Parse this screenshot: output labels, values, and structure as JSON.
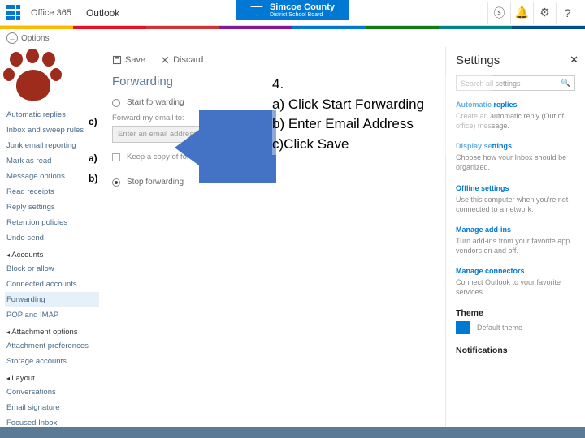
{
  "topbar": {
    "brand1": "Office 365",
    "brand2": "Outlook",
    "topcenter_line1": "Simcoe County",
    "topcenter_line2": "District School Board"
  },
  "subbar": {
    "options_label": "Options"
  },
  "leftnav": {
    "items": [
      "Automatic replies",
      "Inbox and sweep rules",
      "Junk email reporting",
      "Mark as read",
      "Message options",
      "Read receipts",
      "Reply settings",
      "Retention policies",
      "Undo send"
    ],
    "sec_accounts": "Accounts",
    "acc_items": [
      "Block or allow",
      "Connected accounts",
      "Forwarding",
      "POP and IMAP"
    ],
    "sec_attach": "Attachment options",
    "att_items": [
      "Attachment preferences",
      "Storage accounts"
    ],
    "sec_layout": "Layout",
    "lay_items": [
      "Conversations",
      "Email signature",
      "Focused Inbox"
    ]
  },
  "toolbar": {
    "save_label": "Save",
    "discard_label": "Discard"
  },
  "heading": "Forwarding",
  "form": {
    "start_label": "Start forwarding",
    "fwd_label": "Forward my email to:",
    "placeholder": "Enter an email address",
    "keep_label": "Keep a copy of forwarded messages",
    "stop_label": "Stop forwarding"
  },
  "settings": {
    "title": "Settings",
    "search_ph": "Search all settings",
    "auto_t": "Automatic replies",
    "auto_d": "Create an automatic reply (Out of office) message.",
    "disp_t": "Display settings",
    "disp_d": "Choose how your Inbox should be organized.",
    "off_t": "Offline settings",
    "off_d": "Use this computer when you're not connected to a network.",
    "addin_t": "Manage add-ins",
    "addin_d": "Turn add-ins from your favorite app vendors on and off.",
    "conn_t": "Manage connectors",
    "conn_d": "Connect Outlook to your favorite services.",
    "theme_t": "Theme",
    "theme_v": "Default theme",
    "notif_t": "Notifications"
  },
  "annotation": {
    "l0": "4.",
    "l1": "a) Click Start Forwarding",
    "l2": "b) Enter Email  Address",
    "l3": "c)Click Save",
    "a": "a)",
    "b": "b)",
    "c": "c)"
  }
}
